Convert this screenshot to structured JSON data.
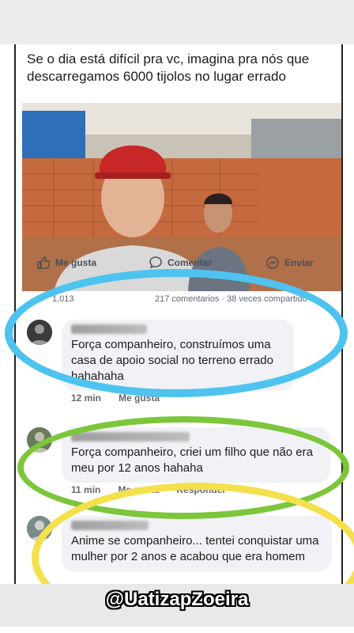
{
  "post": {
    "text": "Se o dia está difícil pra vc, imagina pra nós que descarregamos 6000 tijolos no lugar errado"
  },
  "actions": {
    "like": "Me gusta",
    "comment": "Comentar",
    "share": "Enviar"
  },
  "stats": {
    "reactions": "1,013",
    "comments_shares": "217 comentarios · 38 veces compartido"
  },
  "comments": [
    {
      "text": "Força companheiro, construímos uma casa de apoio social no terreno errado hahahaha",
      "time": "12 min",
      "like": "Me gusta"
    },
    {
      "text": "Força companheiro, criei um filho que não era meu por 12 anos hahaha",
      "time": "11 min",
      "like": "Me gusta",
      "reply": "Responder"
    },
    {
      "text": "Anime se companheiro... tentei conquistar uma mulher por 2 anos e acabou que era homem"
    }
  ],
  "overlay": {
    "handle": "@UatizapZoeira"
  },
  "colors": {
    "highlight_blue": "#4ec3ef",
    "highlight_green": "#7cc63b",
    "highlight_yellow": "#f4e04d"
  }
}
